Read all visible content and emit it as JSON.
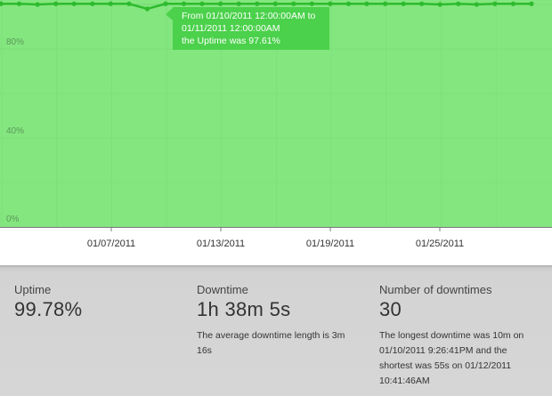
{
  "chart_data": {
    "type": "area",
    "y_ticks": [
      "80%",
      "40%",
      "0%"
    ],
    "x_tick_labels": [
      "01/07/2011",
      "01/13/2011",
      "01/19/2011",
      "01/25/2011"
    ],
    "x_start": "01/02/2011",
    "x_end": "01/31/2011",
    "ylim": [
      0,
      100
    ],
    "series": [
      {
        "x": [
          "01/02/2011",
          "01/03/2011",
          "01/04/2011",
          "01/05/2011",
          "01/06/2011",
          "01/07/2011",
          "01/08/2011",
          "01/09/2011",
          "01/10/2011",
          "01/11/2011",
          "01/12/2011",
          "01/13/2011",
          "01/14/2011",
          "01/15/2011",
          "01/16/2011",
          "01/17/2011",
          "01/18/2011",
          "01/19/2011",
          "01/20/2011",
          "01/21/2011",
          "01/22/2011",
          "01/23/2011",
          "01/24/2011",
          "01/25/2011",
          "01/26/2011",
          "01/27/2011",
          "01/28/2011",
          "01/29/2011",
          "01/30/2011",
          "01/31/2011"
        ],
        "values": [
          99.9,
          99.9,
          99.6,
          99.9,
          99.9,
          99.9,
          99.9,
          99.9,
          97.61,
          99.9,
          99.9,
          99.9,
          99.9,
          99.9,
          99.9,
          99.9,
          99.9,
          99.9,
          99.9,
          99.9,
          99.9,
          99.9,
          99.9,
          99.9,
          99.6,
          99.9,
          99.6,
          99.9,
          99.9,
          99.9
        ]
      }
    ],
    "colors": {
      "fill": "#84e67f",
      "line": "#2dbb2d",
      "grid": "#6cc96b"
    },
    "grid": true
  },
  "tooltip": {
    "line1": "From 01/10/2011 12:00:00AM to",
    "line2": "01/11/2011 12:00:00AM",
    "line3": "the Uptime was 97.61%"
  },
  "stats": {
    "uptime": {
      "label": "Uptime",
      "value": "99.78%"
    },
    "downtime": {
      "label": "Downtime",
      "value": "1h 38m 5s",
      "note": "The average downtime length is 3m 16s"
    },
    "downtimes": {
      "label": "Number of downtimes",
      "value": "30",
      "note": "The longest downtime was 10m on 01/10/2011 9:26:41PM and the shortest was 55s on 01/12/2011 10:41:46AM"
    }
  }
}
